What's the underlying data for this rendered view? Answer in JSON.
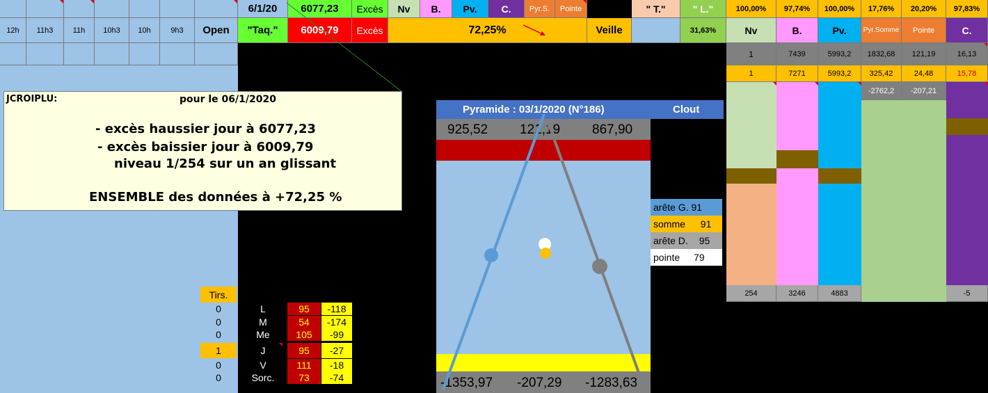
{
  "top_left_strip": {
    "cells": [
      "",
      "",
      "",
      "",
      "",
      "",
      "",
      "",
      ""
    ]
  },
  "hours": [
    "12h",
    "11h3",
    "11h",
    "10h3",
    "10h",
    "9h3"
  ],
  "open_label": "Open",
  "date_cell": "6/1/20",
  "high_value": "6077,23",
  "exces_label_1": "Excès",
  "exces_label_2": "Excès",
  "taq_label": "\"Taq.\"",
  "low_value": "6009,79",
  "percent_center": "72,25%",
  "veille_label": "Veille",
  "top_tags": {
    "nv": "Nv",
    "b": "B.",
    "pv": "Pv.",
    "c": "C.",
    "pyrs": "Pyr.S.",
    "pointe": "Pointe",
    "t": "\" T.\"",
    "l": "\" L.\""
  },
  "l_percent": "31,63%",
  "right_header_pcts": [
    "100,00%",
    "97,74%",
    "100,00%",
    "17,76%",
    "20,20%",
    "97,83%"
  ],
  "right_header_labels": [
    "Nv",
    "B.",
    "Pv.",
    "Pyr.Somme",
    "Pointe",
    "C."
  ],
  "right_row1": [
    "1",
    "7439",
    "5993,2",
    "1832,68",
    "121,19",
    "16,13"
  ],
  "right_row2": [
    "1",
    "7271",
    "5993,2",
    "325,42",
    "24,48",
    "15,78"
  ],
  "right_row3": [
    "-2762,2",
    "-207,21"
  ],
  "right_bottom": [
    "254",
    "3246",
    "4883",
    "-5"
  ],
  "comment": {
    "author": "JCROIPLU:",
    "date_line": "pour le  06/1/2020",
    "line1": "- excès haussier jour à 6077,23",
    "line2": "- excès baissier jour à 6009,79",
    "line3": "niveau 1/254 sur un an glissant",
    "line4": "ENSEMBLE des données à +72,25 %"
  },
  "pyramid": {
    "title": "Pyramide : 03/1/2020 (N°186)",
    "brand": "Clout",
    "top_values": [
      "925,52",
      "121,19",
      "867,90"
    ],
    "bottom_values": [
      "-1353,97",
      "-207,29",
      "-1283,63"
    ]
  },
  "legend": [
    {
      "label": "arête G.",
      "value": "91",
      "color": "#5b9bd5"
    },
    {
      "label": "somme",
      "value": "91",
      "color": "#ffc000"
    },
    {
      "label": "arête D.",
      "value": "95",
      "color": "#a6a6a6"
    },
    {
      "label": "pointe",
      "value": "79",
      "color": "#ffffff"
    }
  ],
  "tirs_label": "Tirs.",
  "days": [
    {
      "count": "0",
      "day": "L",
      "v1": "95",
      "v2": "-118",
      "highlight": false
    },
    {
      "count": "0",
      "day": "M",
      "v1": "54",
      "v2": "-174",
      "highlight": false
    },
    {
      "count": "0",
      "day": "Me",
      "v1": "105",
      "v2": "-99",
      "highlight": false
    },
    {
      "count": "1",
      "day": "J",
      "v1": "95",
      "v2": "-27",
      "highlight": true
    },
    {
      "count": "0",
      "day": "V",
      "v1": "111",
      "v2": "-18",
      "highlight": false
    },
    {
      "count": "0",
      "day": "Sorc.",
      "v1": "73",
      "v2": "-74",
      "highlight": false
    }
  ],
  "colors": {
    "sheet_blue": "#9dc3e6",
    "green": "#92d050",
    "bright_green": "#66ff33",
    "red": "#ff0000",
    "yellow": "#ffff00",
    "orange": "#ffc000",
    "pink": "#ff99ff",
    "cyan": "#00b0f0",
    "purple": "#7030a0",
    "dark_red": "#c00000"
  }
}
